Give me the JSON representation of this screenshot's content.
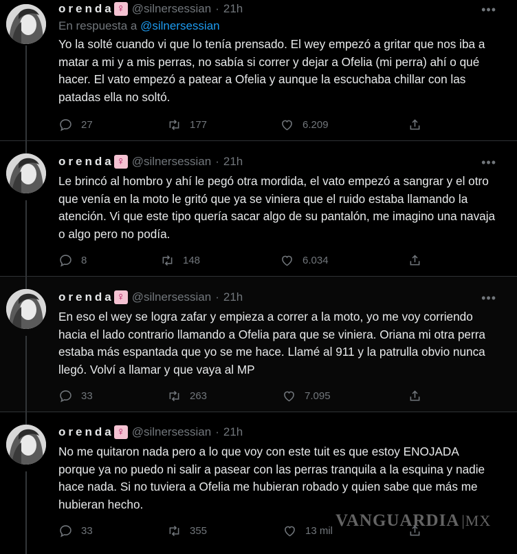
{
  "tweets": [
    {
      "name": "orenda",
      "handle": "@silnersessian",
      "dot": "·",
      "time": "21h",
      "reply_prefix": "En respuesta a ",
      "reply_mention": "@silnersessian",
      "text": "Yo la solté cuando vi que lo tenía prensado. El wey empezó a gritar que nos iba a matar a mi y a mis perras, no sabía si correr y dejar a Ofelia (mi perra) ahí o qué hacer. El vato empezó a patear a Ofelia y aunque la escuchaba chillar con las patadas ella no soltó.",
      "replies": "27",
      "retweets": "177",
      "likes": "6.209"
    },
    {
      "name": "orenda",
      "handle": "@silnersessian",
      "dot": "·",
      "time": "21h",
      "text": "Le brincó al hombro y ahí le pegó otra mordida, el vato empezó a sangrar y el otro que venía en la moto le gritó que ya se viniera que el ruido estaba llamando la atención. Vi que este tipo quería sacar algo de su pantalón, me imagino una navaja o algo pero no podía.",
      "replies": "8",
      "retweets": "148",
      "likes": "6.034"
    },
    {
      "name": "orenda",
      "handle": "@silnersessian",
      "dot": "·",
      "time": "21h",
      "text": "En eso el wey se logra zafar y empieza a correr a la moto, yo me voy corriendo hacia el lado contrario llamando a Ofelia para que se viniera. Oriana mi otra perra estaba más espantada que yo se me hace. Llamé al 911 y la patrulla obvio nunca llegó. Volví a llamar y que vaya al MP",
      "replies": "33",
      "retweets": "263",
      "likes": "7.095"
    },
    {
      "name": "orenda",
      "handle": "@silnersessian",
      "dot": "·",
      "time": "21h",
      "text": "No me quitaron nada pero a lo que voy con este tuit es que estoy ENOJADA porque ya no puedo ni salir a pasear con las perras tranquila a la esquina y nadie hace nada. Si no tuviera a Ofelia me hubieran robado y quien sabe que más me hubieran hecho.",
      "replies": "33",
      "retweets": "355",
      "likes": "13 mil"
    }
  ],
  "watermark": {
    "brand": "VANGUARDIA",
    "suffix": "MX"
  },
  "colors": {
    "background": "#000000",
    "text": "#e7e9ea",
    "muted": "#71767b",
    "link": "#1d9bf0",
    "divider": "#2f3336"
  },
  "icons": [
    "reply-icon",
    "retweet-icon",
    "like-icon",
    "share-icon",
    "more-icon",
    "venus-emoji"
  ]
}
